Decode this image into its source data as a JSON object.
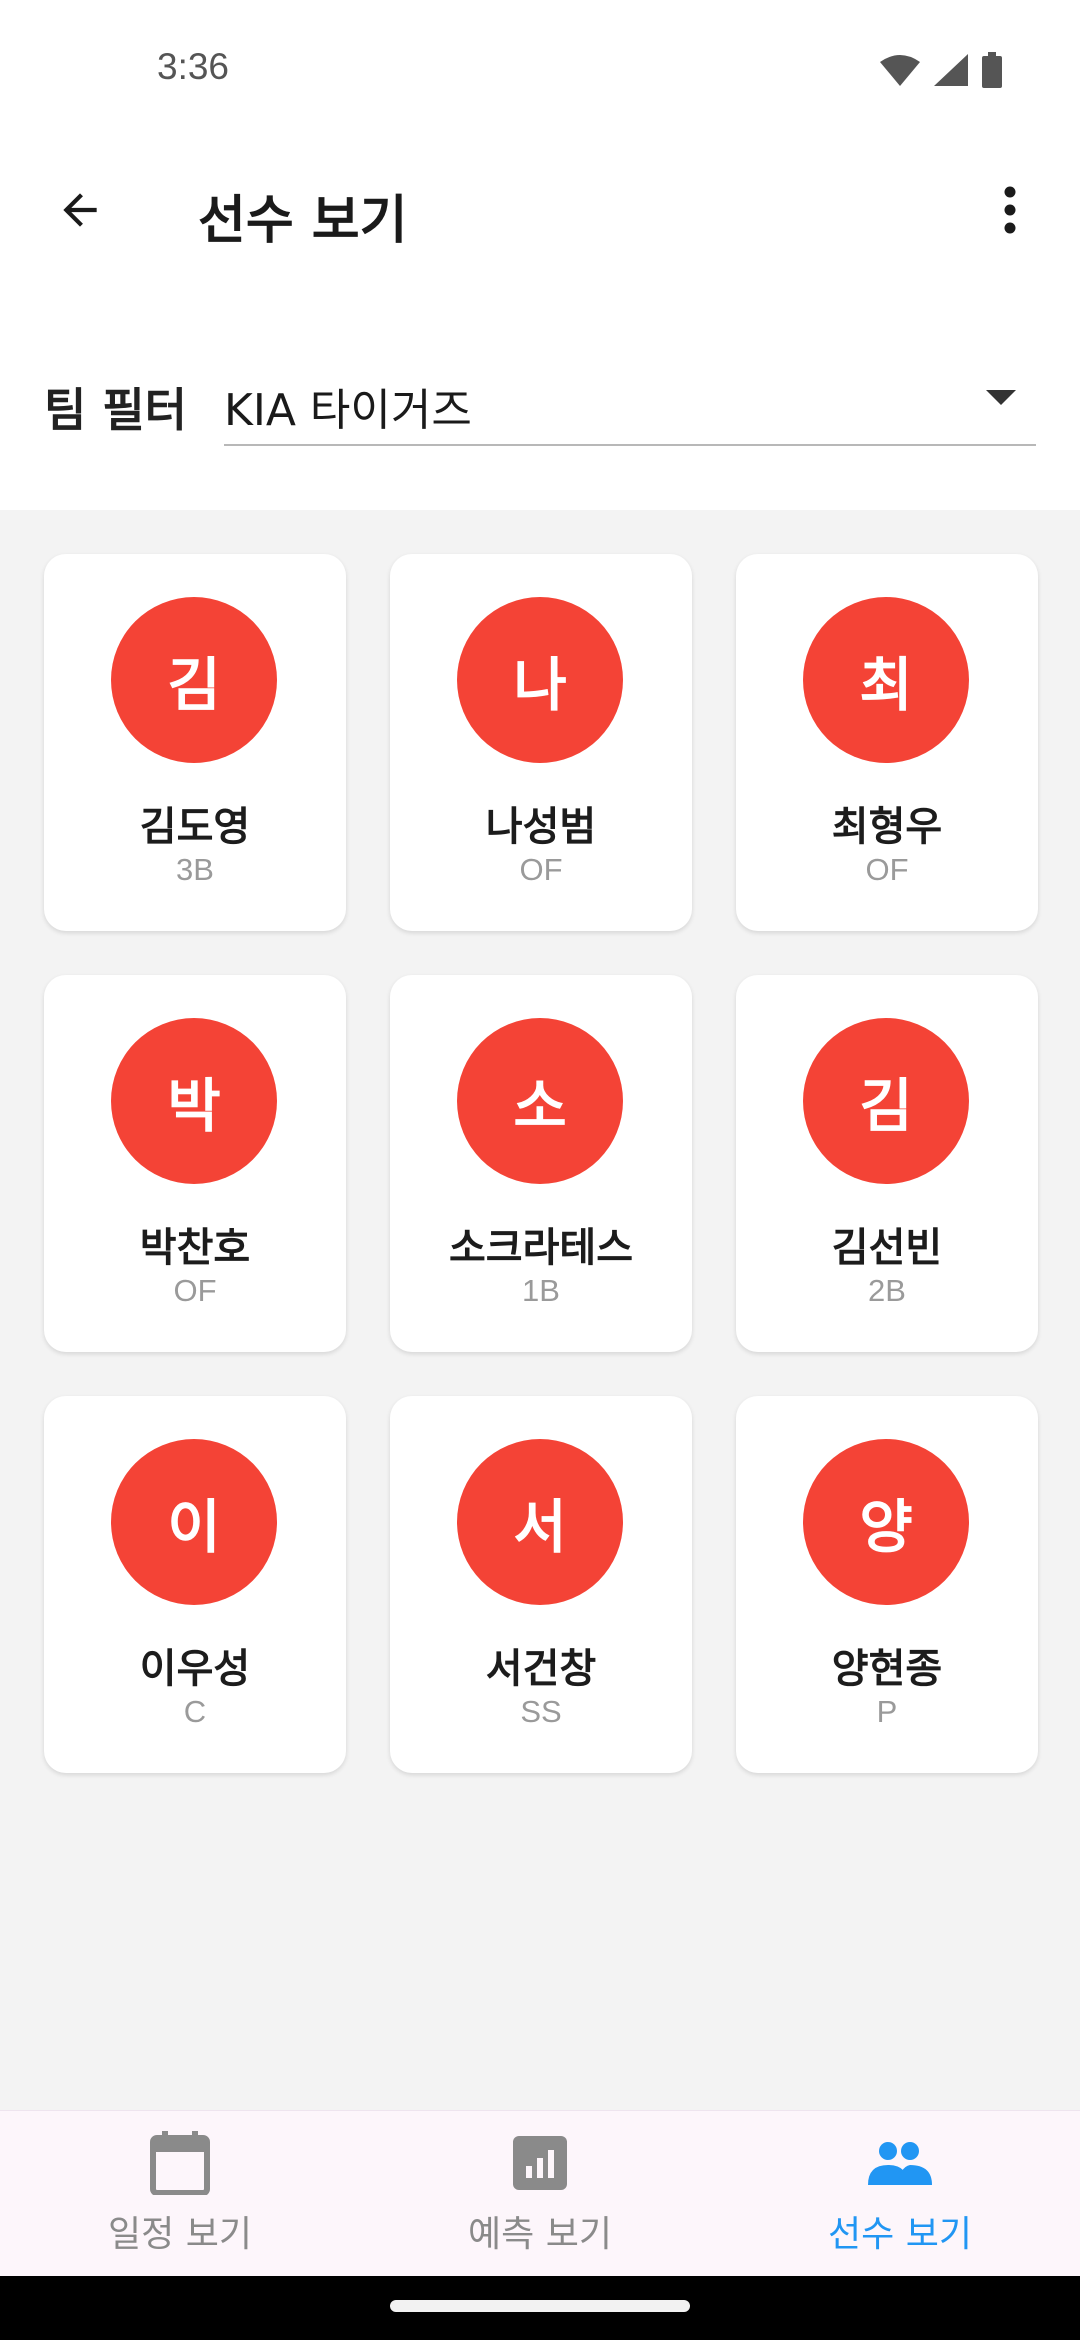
{
  "status_bar": {
    "time": "3:36"
  },
  "app_bar": {
    "title": "선수 보기"
  },
  "filter": {
    "label": "팀 필터",
    "selected": "KIA 타이거즈"
  },
  "players": [
    {
      "initial": "김",
      "name": "김도영",
      "position": "3B"
    },
    {
      "initial": "나",
      "name": "나성범",
      "position": "OF"
    },
    {
      "initial": "최",
      "name": "최형우",
      "position": "OF"
    },
    {
      "initial": "박",
      "name": "박찬호",
      "position": "OF"
    },
    {
      "initial": "소",
      "name": "소크라테스",
      "position": "1B"
    },
    {
      "initial": "김",
      "name": "김선빈",
      "position": "2B"
    },
    {
      "initial": "이",
      "name": "이우성",
      "position": "C"
    },
    {
      "initial": "서",
      "name": "서건창",
      "position": "SS"
    },
    {
      "initial": "양",
      "name": "양현종",
      "position": "P"
    }
  ],
  "bottom_nav": {
    "items": [
      {
        "label": "일정 보기",
        "icon": "calendar-icon"
      },
      {
        "label": "예측 보기",
        "icon": "chart-icon"
      },
      {
        "label": "선수 보기",
        "icon": "people-icon",
        "active": true
      }
    ]
  },
  "colors": {
    "avatar": "#f44336",
    "accent": "#2196f3",
    "inactive": "#8a8a8a"
  }
}
